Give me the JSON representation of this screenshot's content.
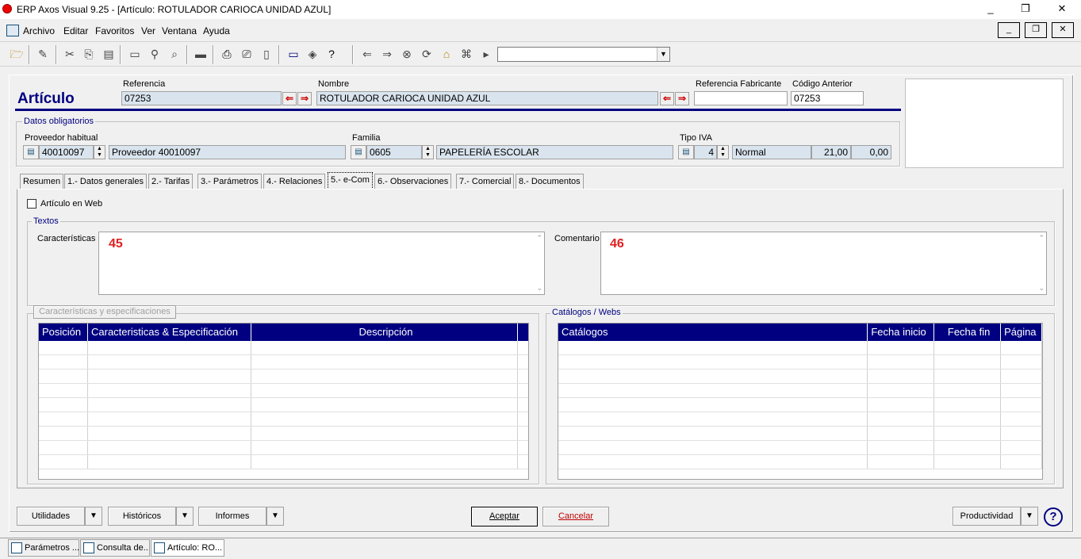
{
  "window": {
    "title": "ERP Axos Visual 9.25 - [Artículo: ROTULADOR CARIOCA UNIDAD AZUL]",
    "minimize": "_",
    "restore": "❐",
    "close": "✕"
  },
  "menu": {
    "items": [
      "Archivo",
      "Editar",
      "Favoritos",
      "Ver",
      "Ventana",
      "Ayuda"
    ],
    "mdi_min": "_",
    "mdi_restore": "❐",
    "mdi_close": "✕"
  },
  "form": {
    "heading": "Artículo",
    "referencia_label": "Referencia",
    "referencia_value": "07253",
    "nombre_label": "Nombre",
    "nombre_value": "ROTULADOR CARIOCA UNIDAD AZUL",
    "ref_fabricante_label": "Referencia Fabricante",
    "ref_fabricante_value": "",
    "codigo_anterior_label": "Código Anterior",
    "codigo_anterior_value": "07253",
    "datos_obligatorios": "Datos obligatorios",
    "proveedor_label": "Proveedor habitual",
    "proveedor_code": "40010097",
    "proveedor_name": "Proveedor 40010097",
    "familia_label": "Familia",
    "familia_code": "0605",
    "familia_name": "PAPELERÍA ESCOLAR",
    "iva_label": "Tipo IVA",
    "iva_code": "4",
    "iva_name": "Normal",
    "iva_pct": "21,00",
    "iva_re": "0,00"
  },
  "tabs": [
    "Resumen",
    "1.- Datos generales",
    "2.- Tarifas",
    "3.- Parámetros",
    "4.- Relaciones",
    "5.- e-Com",
    "6.- Observaciones",
    "7.- Comercial",
    "8.- Documentos"
  ],
  "ecom": {
    "articulo_web_label": "Artículo en Web",
    "articulo_web_checked": false,
    "textos_label": "Textos",
    "caracteristicas_label": "Características",
    "caracteristicas_value": "45",
    "comentario_label": "Comentario",
    "comentario_value": "46",
    "specs_group_label": "Características y especificaciones",
    "specs_columns": [
      "Posición",
      "Caracteristicas & Especificación",
      "Descripción"
    ],
    "catalogos_group_label": "Catálogos / Webs",
    "catalogos_columns": [
      "Catálogos",
      "Fecha inicio",
      "Fecha fin",
      "Página"
    ]
  },
  "footer": {
    "utilidades": "Utilidades",
    "historicos": "Históricos",
    "informes": "Informes",
    "aceptar": "Aceptar",
    "cancelar": "Cancelar",
    "productividad": "Productividad",
    "help": "?"
  },
  "taskbar": [
    "Parámetros ...",
    "Consulta de...",
    "Artículo: RO..."
  ]
}
